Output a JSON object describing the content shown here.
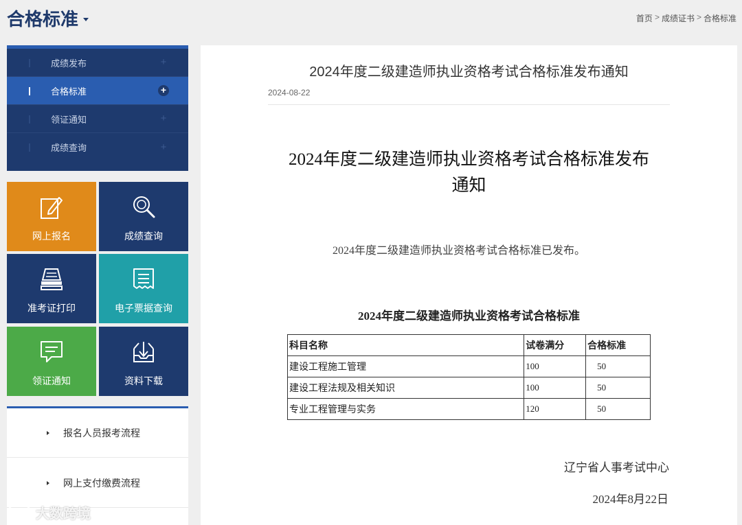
{
  "header": {
    "title": "合格标准",
    "breadcrumb": [
      "首页",
      "成绩证书",
      "合格标准"
    ],
    "breadcrumb_sep": ">"
  },
  "sidebar": {
    "menu": [
      {
        "label": "成绩发布",
        "active": false
      },
      {
        "label": "合格标准",
        "active": true
      },
      {
        "label": "领证通知",
        "active": false
      },
      {
        "label": "成绩查询",
        "active": false
      }
    ],
    "plus_glyph": "+",
    "tiles": [
      {
        "label": "网上报名",
        "color": "#e08a1a",
        "icon": "edit-icon"
      },
      {
        "label": "成绩查询",
        "color": "#1e3a6e",
        "icon": "search-icon"
      },
      {
        "label": "准考证打印",
        "color": "#1e3a6e",
        "icon": "printer-icon"
      },
      {
        "label": "电子票据查询",
        "color": "#20a0a8",
        "icon": "receipt-icon"
      },
      {
        "label": "领证通知",
        "color": "#4caa48",
        "icon": "message-icon"
      },
      {
        "label": "资料下载",
        "color": "#1e3a6e",
        "icon": "download-icon"
      }
    ],
    "flows": [
      {
        "label": "报名人员报考流程"
      },
      {
        "label": "网上支付缴费流程"
      }
    ]
  },
  "article": {
    "title": "2024年度二级建造师执业资格考试合格标准发布通知",
    "date": "2024-08-22",
    "doc_title_line1": "2024年度二级建造师执业资格考试合格标准发布",
    "doc_title_line2": "通知",
    "paragraph": "2024年度二级建造师执业资格考试合格标准已发布。",
    "table_title": "2024年度二级建造师执业资格考试合格标准",
    "table": {
      "headers": [
        "科目名称",
        "试卷满分",
        "合格标准"
      ],
      "rows": [
        [
          "建设工程施工管理",
          "100",
          "50"
        ],
        [
          "建设工程法规及相关知识",
          "100",
          "50"
        ],
        [
          "专业工程管理与实务",
          "120",
          "50"
        ]
      ]
    },
    "issuer": "辽宁省人事考试中心",
    "issue_date": "2024年8月22日"
  },
  "watermark": "大数跨境"
}
